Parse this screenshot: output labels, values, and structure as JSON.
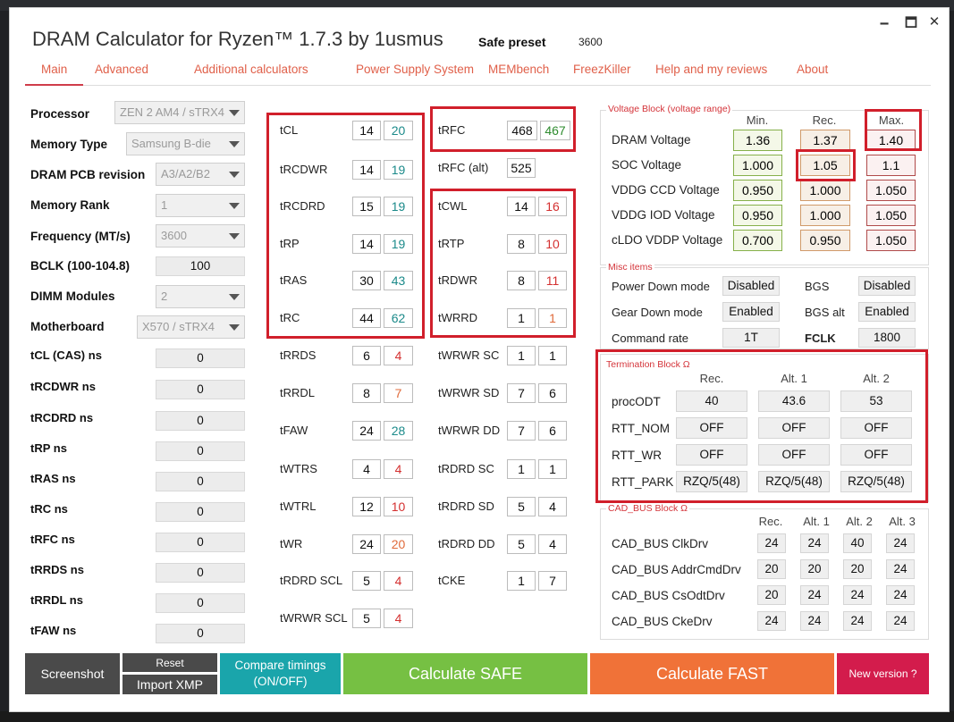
{
  "app": {
    "title": "DRAM Calculator for Ryzen™ 1.7.3 by 1usmus",
    "preset_label": "Safe preset",
    "preset_value": "3600",
    "min_glyph": "🗕",
    "max_glyph": "🗖",
    "close_glyph": "✕"
  },
  "nav": [
    "Main",
    "Advanced",
    "Additional calculators",
    "Power Supply System",
    "MEMbench",
    "FreezKiller",
    "Help and my reviews",
    "About"
  ],
  "left": {
    "processor": {
      "label": "Processor",
      "value": "ZEN 2 AM4 / sTRX4"
    },
    "memory_type": {
      "label": "Memory Type",
      "value": "Samsung B-die"
    },
    "pcb": {
      "label": "DRAM PCB revision",
      "value": "A3/A2/B2"
    },
    "rank": {
      "label": "Memory Rank",
      "value": "1"
    },
    "frequency": {
      "label": "Frequency (MT/s)",
      "value": "3600"
    },
    "bclk": {
      "label": "BCLK (100-104.8)",
      "value": "100"
    },
    "dimm": {
      "label": "DIMM Modules",
      "value": "2"
    },
    "motherboard": {
      "label": "Motherboard",
      "value": "X570 / sTRX4"
    },
    "ns": [
      {
        "label": "tCL (CAS) ns",
        "value": "0"
      },
      {
        "label": "tRCDWR ns",
        "value": "0"
      },
      {
        "label": "tRCDRD ns",
        "value": "0"
      },
      {
        "label": "tRP ns",
        "value": "0"
      },
      {
        "label": "tRAS ns",
        "value": "0"
      },
      {
        "label": "tRC ns",
        "value": "0"
      },
      {
        "label": "tRFC ns",
        "value": "0"
      },
      {
        "label": "tRRDS ns",
        "value": "0"
      },
      {
        "label": "tRRDL ns",
        "value": "0"
      },
      {
        "label": "tFAW ns",
        "value": "0"
      }
    ]
  },
  "timings1": [
    {
      "label": "tCL",
      "a": "14",
      "b": "20",
      "color": "#1b8a8a"
    },
    {
      "label": "tRCDWR",
      "a": "14",
      "b": "19",
      "color": "#1b8a8a"
    },
    {
      "label": "tRCDRD",
      "a": "15",
      "b": "19",
      "color": "#1b8a8a"
    },
    {
      "label": "tRP",
      "a": "14",
      "b": "19",
      "color": "#1b8a8a"
    },
    {
      "label": "tRAS",
      "a": "30",
      "b": "43",
      "color": "#1b8a8a"
    },
    {
      "label": "tRC",
      "a": "44",
      "b": "62",
      "color": "#1b8a8a"
    },
    {
      "label": "tRRDS",
      "a": "6",
      "b": "4",
      "color": "#d43030"
    },
    {
      "label": "tRRDL",
      "a": "8",
      "b": "7",
      "color": "#e06a3a"
    },
    {
      "label": "tFAW",
      "a": "24",
      "b": "28",
      "color": "#1b8a8a"
    },
    {
      "label": "tWTRS",
      "a": "4",
      "b": "4",
      "color": "#d43030"
    },
    {
      "label": "tWTRL",
      "a": "12",
      "b": "10",
      "color": "#d43030"
    },
    {
      "label": "tWR",
      "a": "24",
      "b": "20",
      "color": "#e06a3a"
    },
    {
      "label": "tRDRD SCL",
      "a": "5",
      "b": "4",
      "color": "#d43030"
    },
    {
      "label": "tWRWR SCL",
      "a": "5",
      "b": "4",
      "color": "#d43030"
    }
  ],
  "timings2": [
    {
      "label": "tRFC",
      "a": "468",
      "b": "467",
      "color": "#2e8b2e"
    },
    {
      "label": "tRFC (alt)",
      "a": "525"
    },
    {
      "label": "tCWL",
      "a": "14",
      "b": "16",
      "color": "#d43030"
    },
    {
      "label": "tRTP",
      "a": "8",
      "b": "10",
      "color": "#d43030"
    },
    {
      "label": "tRDWR",
      "a": "8",
      "b": "11",
      "color": "#d43030"
    },
    {
      "label": "tWRRD",
      "a": "1",
      "b": "1",
      "color": "#e06a3a"
    },
    {
      "label": "tWRWR SC",
      "a": "1",
      "b": "1",
      "color": "#111111"
    },
    {
      "label": "tWRWR SD",
      "a": "7",
      "b": "6",
      "color": "#111111"
    },
    {
      "label": "tWRWR DD",
      "a": "7",
      "b": "6",
      "color": "#111111"
    },
    {
      "label": "tRDRD SC",
      "a": "1",
      "b": "1",
      "color": "#111111"
    },
    {
      "label": "tRDRD SD",
      "a": "5",
      "b": "4",
      "color": "#111111"
    },
    {
      "label": "tRDRD DD",
      "a": "5",
      "b": "4",
      "color": "#111111"
    },
    {
      "label": "tCKE",
      "a": "1",
      "b": "7",
      "color": "#111111"
    }
  ],
  "voltage": {
    "title": "Voltage Block (voltage range)",
    "headers": [
      "Min.",
      "Rec.",
      "Max."
    ],
    "rows": [
      {
        "label": "DRAM Voltage",
        "min": "1.36",
        "rec": "1.37",
        "max": "1.40"
      },
      {
        "label": "SOC Voltage",
        "min": "1.000",
        "rec": "1.05",
        "max": "1.1"
      },
      {
        "label": "VDDG  CCD Voltage",
        "min": "0.950",
        "rec": "1.000",
        "max": "1.050"
      },
      {
        "label": "VDDG  IOD Voltage",
        "min": "0.950",
        "rec": "1.000",
        "max": "1.050"
      },
      {
        "label": "cLDO VDDP Voltage",
        "min": "0.700",
        "rec": "0.950",
        "max": "1.050"
      }
    ]
  },
  "misc": {
    "title": "Misc items",
    "power_down": {
      "label": "Power Down mode",
      "value": "Disabled"
    },
    "bgs": {
      "label": "BGS",
      "value": "Disabled"
    },
    "gear_down": {
      "label": "Gear Down mode",
      "value": "Enabled"
    },
    "bgs_alt": {
      "label": "BGS alt",
      "value": "Enabled"
    },
    "cmd_rate": {
      "label": "Command rate",
      "value": "1T"
    },
    "fclk": {
      "label": "FCLK",
      "value": "1800"
    }
  },
  "termination": {
    "title": "Termination Block Ω",
    "headers": [
      "Rec.",
      "Alt. 1",
      "Alt. 2"
    ],
    "rows": [
      {
        "label": "procODT",
        "v": [
          "40",
          "43.6",
          "53"
        ]
      },
      {
        "label": "RTT_NOM",
        "v": [
          "OFF",
          "OFF",
          "OFF"
        ]
      },
      {
        "label": "RTT_WR",
        "v": [
          "OFF",
          "OFF",
          "OFF"
        ]
      },
      {
        "label": "RTT_PARK",
        "v": [
          "RZQ/5(48)",
          "RZQ/5(48)",
          "RZQ/5(48)"
        ]
      }
    ]
  },
  "cadbus": {
    "title": "CAD_BUS Block Ω",
    "headers": [
      "Rec.",
      "Alt. 1",
      "Alt. 2",
      "Alt. 3"
    ],
    "rows": [
      {
        "label": "CAD_BUS ClkDrv",
        "v": [
          "24",
          "24",
          "40",
          "24"
        ]
      },
      {
        "label": "CAD_BUS AddrCmdDrv",
        "v": [
          "20",
          "20",
          "20",
          "24"
        ]
      },
      {
        "label": "CAD_BUS CsOdtDrv",
        "v": [
          "20",
          "24",
          "24",
          "24"
        ]
      },
      {
        "label": "CAD_BUS CkeDrv",
        "v": [
          "24",
          "24",
          "24",
          "24"
        ]
      }
    ]
  },
  "buttons": {
    "screenshot": "Screenshot",
    "reset": "Reset",
    "import_xmp": "Import XMP",
    "compare": "Compare timings (ON/OFF)",
    "calc_safe": "Calculate SAFE",
    "calc_fast": "Calculate FAST",
    "new_version": "New version ?"
  },
  "colors": {
    "accent_red": "#d11f2b",
    "nav_text": "#e0604a",
    "screenshot_bg": "#4a4a4a",
    "compare_bg": "#1aa5ab",
    "safe_bg": "#76c043",
    "fast_bg": "#f07238",
    "new_version_bg": "#d31c4c"
  }
}
